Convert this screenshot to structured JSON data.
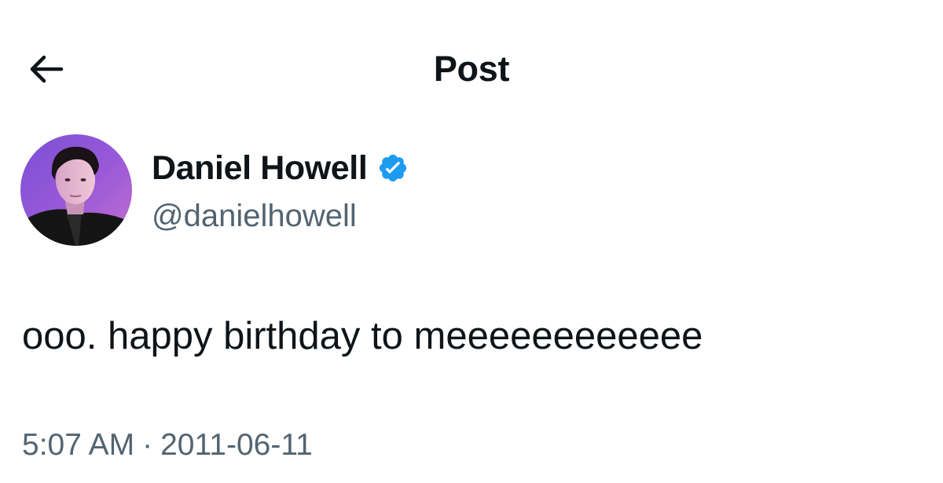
{
  "header": {
    "back_icon": "arrow-left-icon",
    "title": "Post"
  },
  "author": {
    "display_name": "Daniel Howell",
    "verified_icon": "verified-badge-icon",
    "verified_color": "#1d9bf0",
    "handle": "@danielhowell",
    "avatar_icon": "profile-photo"
  },
  "post": {
    "text": "ooo. happy birthday to meeeeeeeeeeee",
    "time": "5:07 AM",
    "separator": "·",
    "date": "2011-06-11"
  },
  "colors": {
    "text_primary": "#0f1419",
    "text_secondary": "#536471",
    "background": "#ffffff"
  }
}
